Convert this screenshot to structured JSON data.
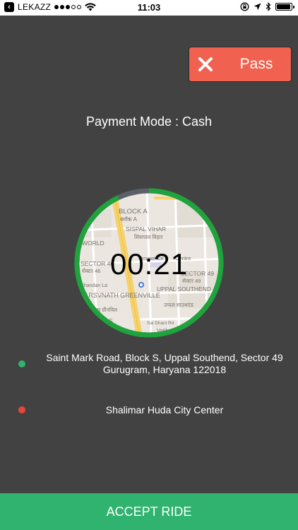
{
  "status_bar": {
    "carrier": "LEKAZZ",
    "time": "11:03",
    "back_icon": "back-arrow-icon",
    "signal_icon": "signal-dots-icon",
    "wifi_icon": "wifi-icon",
    "lock_icon": "orientation-lock-icon",
    "location_icon": "location-arrow-icon",
    "bluetooth_icon": "bluetooth-icon",
    "battery_icon": "battery-icon",
    "battery_level": 0.95
  },
  "pass_button": {
    "label": "Pass",
    "icon": "close-icon",
    "color": "#f0624f"
  },
  "payment_mode": "Payment Mode : Cash",
  "timer": {
    "value": "00:21",
    "progress": 0.93,
    "ring_color": "#1fa33c",
    "track_color": "#5a6169",
    "map_labels": [
      "BLOCK A",
      "ब्लॉक A",
      "SISPAL VIHAR",
      "सिसपाल विहार",
      "WORLD",
      "SECTOR 46",
      "सेक्टर 46",
      "SECTOR 49",
      "सेक्टर 49",
      "PARSVNATH GREENVILLE",
      "पार्श्वनाथ ग्रीनविल",
      "UPPAL SOUTHEND",
      "उप्पल साउथएंड",
      "N VILLAS",
      "Sai Dhani Rd",
      "Vatika Bu",
      "n Chandan La",
      "Omaxe Cit",
      "Centre"
    ]
  },
  "pickup": {
    "address_line1": "Saint Mark Road, Block S, Uppal Southend, Sector 49",
    "address_line2": "Gurugram, Haryana 122018",
    "dot_color": "#2fb36f"
  },
  "dropoff": {
    "address": "Shalimar Huda City Center",
    "dot_color": "#e8453c"
  },
  "accept_button": {
    "label": "ACCEPT RIDE",
    "color": "#2fb36f"
  }
}
